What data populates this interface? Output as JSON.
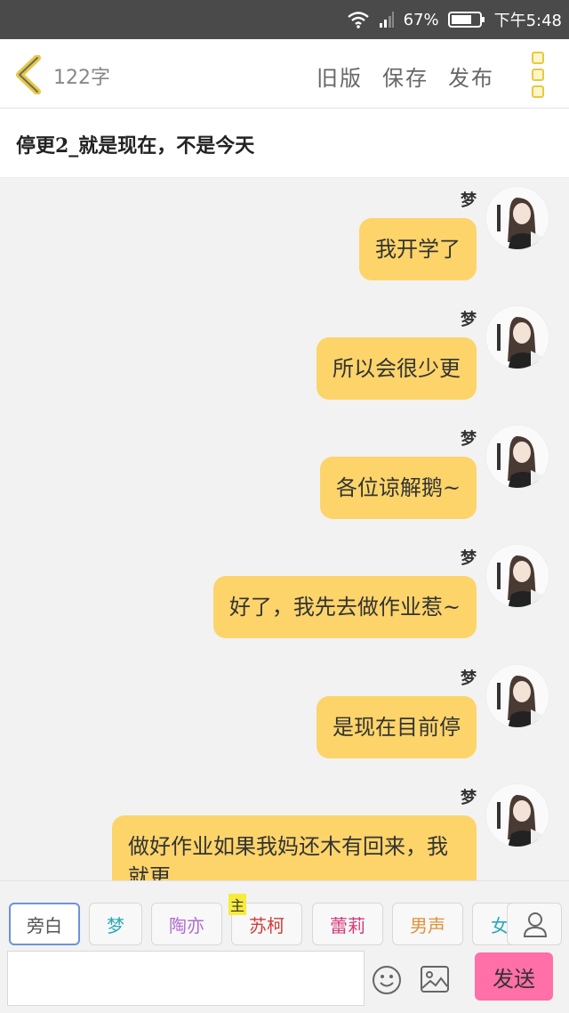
{
  "status_bar": {
    "battery_percent": "67%",
    "time": "下午5:48"
  },
  "toolbar": {
    "word_count": "122字",
    "old_version_label": "旧版",
    "save_label": "保存",
    "publish_label": "发布"
  },
  "chapter": {
    "title": "停更2_就是现在，不是今天"
  },
  "messages": [
    {
      "speaker": "梦",
      "text": "我开学了"
    },
    {
      "speaker": "梦",
      "text": "所以会很少更"
    },
    {
      "speaker": "梦",
      "text": "各位谅解鹅~"
    },
    {
      "speaker": "梦",
      "text": "好了，我先去做作业惹~"
    },
    {
      "speaker": "梦",
      "text": "是现在目前停"
    },
    {
      "speaker": "梦",
      "text": "做好作业如果我妈还木有回来，我就更"
    }
  ],
  "roles": [
    {
      "label": "旁白",
      "color": "#555555"
    },
    {
      "label": "梦",
      "color": "#2aa9b5"
    },
    {
      "label": "陶亦",
      "color": "#b06ad6"
    },
    {
      "label": "苏柯",
      "color": "#d33a3a"
    },
    {
      "label": "蕾莉",
      "color": "#d23a7c"
    },
    {
      "label": "男声",
      "color": "#e0913b"
    },
    {
      "label": "女",
      "color": "#2aa9b5"
    }
  ],
  "role_tag": "主",
  "send_label": "发送",
  "colors": {
    "bubble": "#fcd46a",
    "send_button": "#ff6fa8",
    "accent": "#e8c840"
  }
}
